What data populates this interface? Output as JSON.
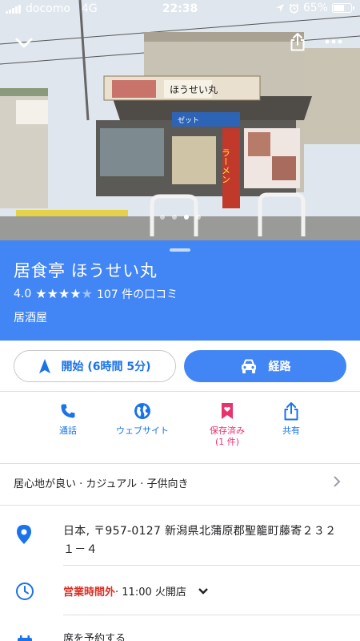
{
  "status_bar": {
    "carrier": "docomo",
    "network": "4G",
    "time": "22:38",
    "battery": "65%",
    "battery_level": 0.65
  },
  "hero": {
    "back_icon": "chevron-down-icon",
    "share_icon": "share-icon",
    "more_icon": "more-horiz-icon",
    "sign_main": "ほうせい丸",
    "sign_side": "ラーメン",
    "sign_small": "ゼット",
    "photo_index": 3,
    "photo_count": 4
  },
  "place": {
    "name": "居食亭 ほうせい丸",
    "rating": "4.0",
    "stars": 4,
    "reviews": "107 件の口コミ",
    "category": "居酒屋"
  },
  "buttons": {
    "start_label": "開始 (6時間 5分)",
    "route_label": "経路"
  },
  "actions": [
    {
      "label": "通話",
      "sub": "",
      "icon": "phone-icon"
    },
    {
      "label": "ウェブサイト",
      "sub": "",
      "icon": "globe-icon"
    },
    {
      "label": "保存済み",
      "sub": "(1 件)",
      "icon": "bookmark-icon"
    },
    {
      "label": "共有",
      "sub": "",
      "icon": "share-icon"
    }
  ],
  "atmosphere": "居心地が良い · カジュアル · 子供向き",
  "address": "日本, 〒957-0127 新潟県北蒲原郡聖籠町藤寄２３２１－４",
  "hours": {
    "status": "営業時間外",
    "detail": " · 11:00 火開店"
  },
  "reserve": "席を予約する",
  "colors": {
    "brand_blue": "#4285f4",
    "link_blue": "#1a73e8",
    "saved_pink": "#e8336d",
    "closed_red": "#d93025"
  }
}
